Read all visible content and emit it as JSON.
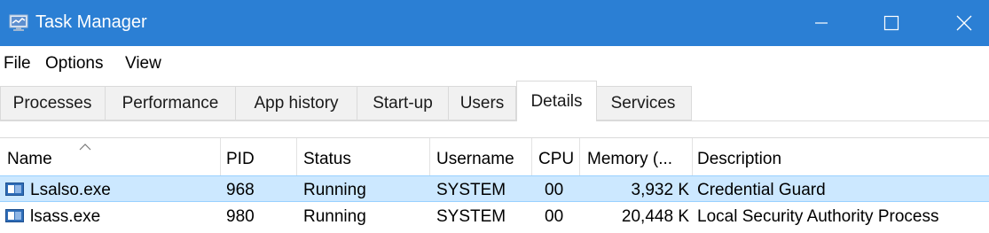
{
  "window": {
    "title": "Task Manager",
    "accent_color": "#2b7fd4",
    "controls": {
      "minimize": "minimize-icon",
      "maximize": "maximize-icon",
      "close": "close-icon"
    }
  },
  "menu": [
    "File",
    "Options",
    "View"
  ],
  "tabs": [
    {
      "label": "Processes"
    },
    {
      "label": "Performance"
    },
    {
      "label": "App history"
    },
    {
      "label": "Start-up"
    },
    {
      "label": "Users"
    },
    {
      "label": "Details",
      "active": true
    },
    {
      "label": "Services"
    }
  ],
  "table": {
    "sort_column": "Name",
    "sort_direction": "ascending",
    "columns": [
      "Name",
      "PID",
      "Status",
      "Username",
      "CPU",
      "Memory (...",
      "Description"
    ],
    "rows": [
      {
        "name": "Lsalso.exe",
        "pid": "968",
        "status": "Running",
        "username": "SYSTEM",
        "cpu": "00",
        "memory": "3,932 K",
        "description": "Credential Guard",
        "selected": true
      },
      {
        "name": "lsass.exe",
        "pid": "980",
        "status": "Running",
        "username": "SYSTEM",
        "cpu": "00",
        "memory": "20,448 K",
        "description": "Local Security Authority Process",
        "selected": false
      }
    ]
  },
  "colors": {
    "selection": "#cce8ff",
    "selection_border": "#99d1ff"
  }
}
